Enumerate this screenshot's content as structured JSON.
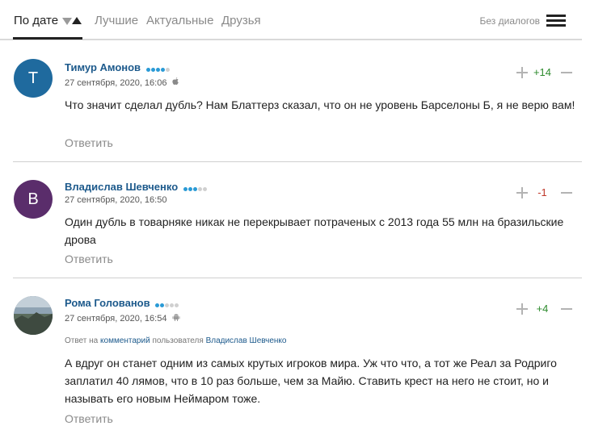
{
  "tabs": {
    "by_date": "По дате",
    "best": "Лучшие",
    "actual": "Актуальные",
    "friends": "Друзья",
    "no_dialogs": "Без диалогов"
  },
  "colors": {
    "accent_link": "#1d5a8c",
    "positive": "#2e8b2e",
    "negative": "#c0392b",
    "rating_dot": "#2a9ad6"
  },
  "comments": [
    {
      "avatar_letter": "Т",
      "avatar_color": "#1f6a9e",
      "author": "Тимур Амонов",
      "rating_level": 4,
      "rating_max": 5,
      "date": "27 сентября, 2020, 16:06",
      "platform_icon": "apple-icon",
      "text": "Что значит сделал дубль? Нам Блаттерз сказал, что он не уровень Барселоны Б, я не верю вам!",
      "reply_label": "Ответить",
      "score": "+14"
    },
    {
      "avatar_letter": "В",
      "avatar_color": "#5a2d6b",
      "author": "Владислав Шевченко",
      "rating_level": 3,
      "rating_max": 5,
      "date": "27 сентября, 2020, 16:50",
      "platform_icon": "",
      "text": "Один дубль в товарняке никак не перекрывает потраченых с 2013 года 55 млн на бразильские дрова",
      "reply_label": "Ответить",
      "score": "-1"
    },
    {
      "avatar_letter": "",
      "avatar_color": "#6f7d86",
      "author": "Рома Голованов",
      "rating_level": 2,
      "rating_max": 5,
      "date": "27 сентября, 2020, 16:54",
      "platform_icon": "android-icon",
      "reply_prefix": "Ответ на",
      "reply_comment_link": "комментарий",
      "reply_middle": "пользователя",
      "reply_user": "Владислав Шевченко",
      "text": "А вдруг он станет одним из самых крутых игроков мира. Уж что что, а тот же Реал за Родриго заплатил 40 лямов, что в 10 раз больше, чем за Майю. Ставить крест на него не стоит, но и называть его новым Неймаром тоже.",
      "reply_label": "Ответить",
      "score": "+4"
    }
  ]
}
